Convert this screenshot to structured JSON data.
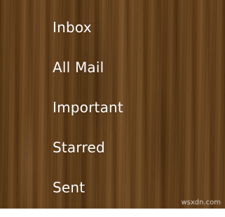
{
  "menu": {
    "items": [
      {
        "label": "Inbox"
      },
      {
        "label": "All Mail"
      },
      {
        "label": "Important"
      },
      {
        "label": "Starred"
      },
      {
        "label": "Sent"
      }
    ]
  },
  "watermark": "wsxdn.com",
  "colors": {
    "background": "#634019",
    "text": "#ffffff"
  }
}
